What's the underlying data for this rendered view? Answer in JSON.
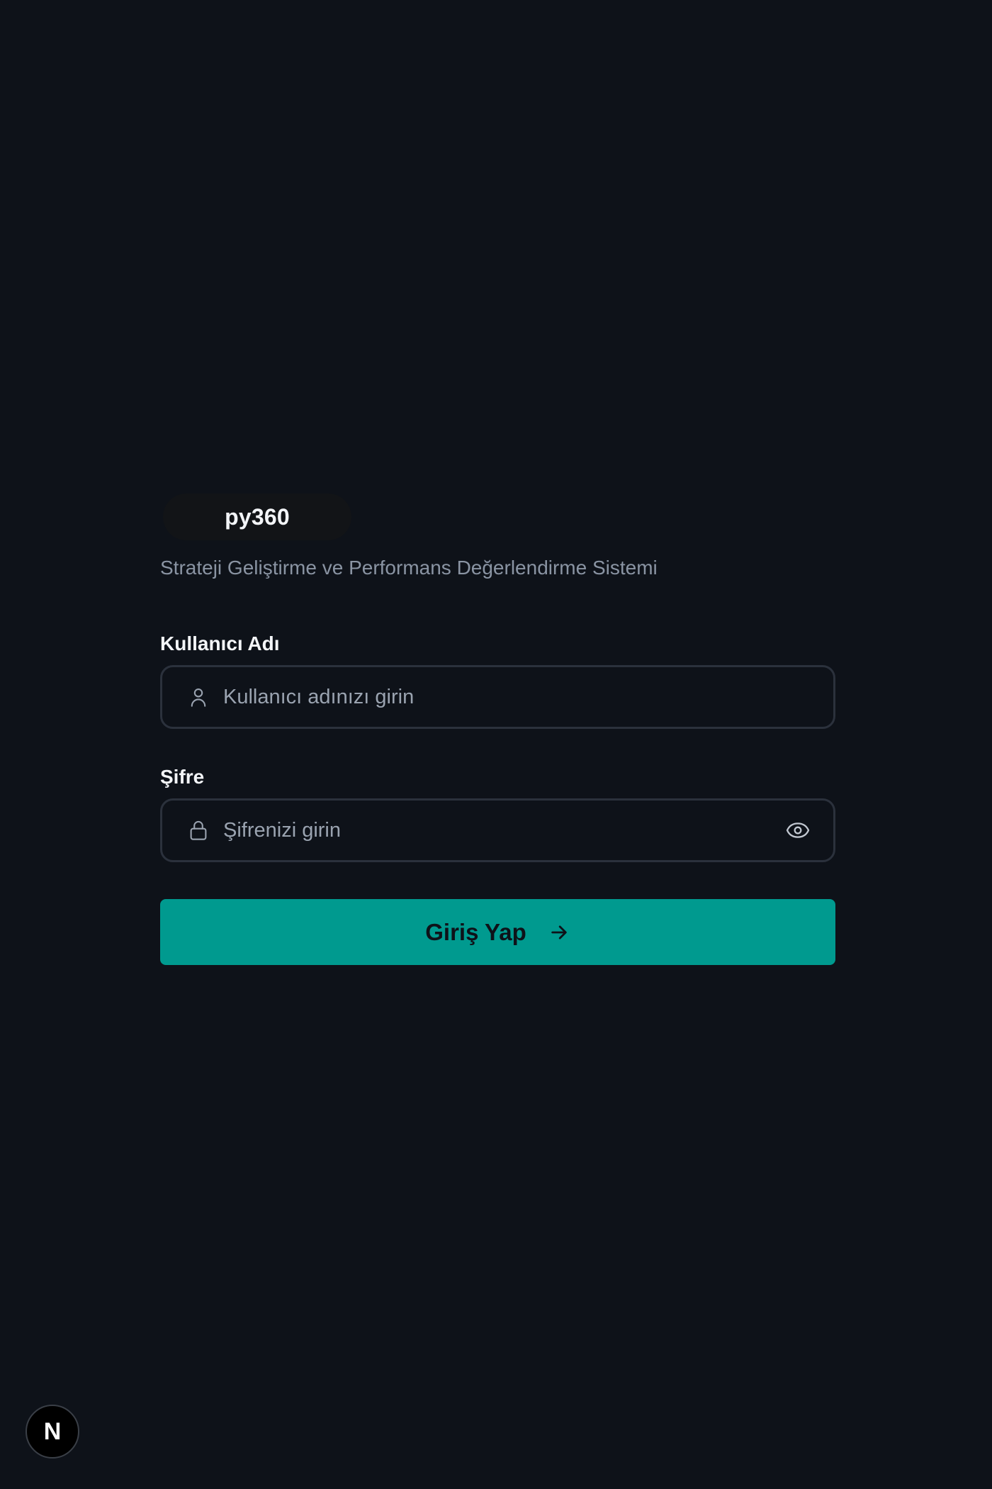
{
  "brand": {
    "name": "py360"
  },
  "subtitle": "Strateji Geliştirme ve Performans Değerlendirme Sistemi",
  "form": {
    "username": {
      "label": "Kullanıcı Adı",
      "placeholder": "Kullanıcı adınızı girin",
      "value": "",
      "icon": "user-icon"
    },
    "password": {
      "label": "Şifre",
      "placeholder": "Şifrenizi girin",
      "value": "",
      "icon": "lock-icon",
      "toggle_icon": "eye-icon"
    },
    "submit": {
      "label": "Giriş Yap",
      "icon": "arrow-right-icon"
    }
  },
  "dev_badge": {
    "letter": "N",
    "icon": "nextjs-logo-icon"
  },
  "colors": {
    "background": "#0e1219",
    "accent": "#009a8f",
    "input_border": "#2b313c",
    "muted_text": "#8a94a3"
  }
}
